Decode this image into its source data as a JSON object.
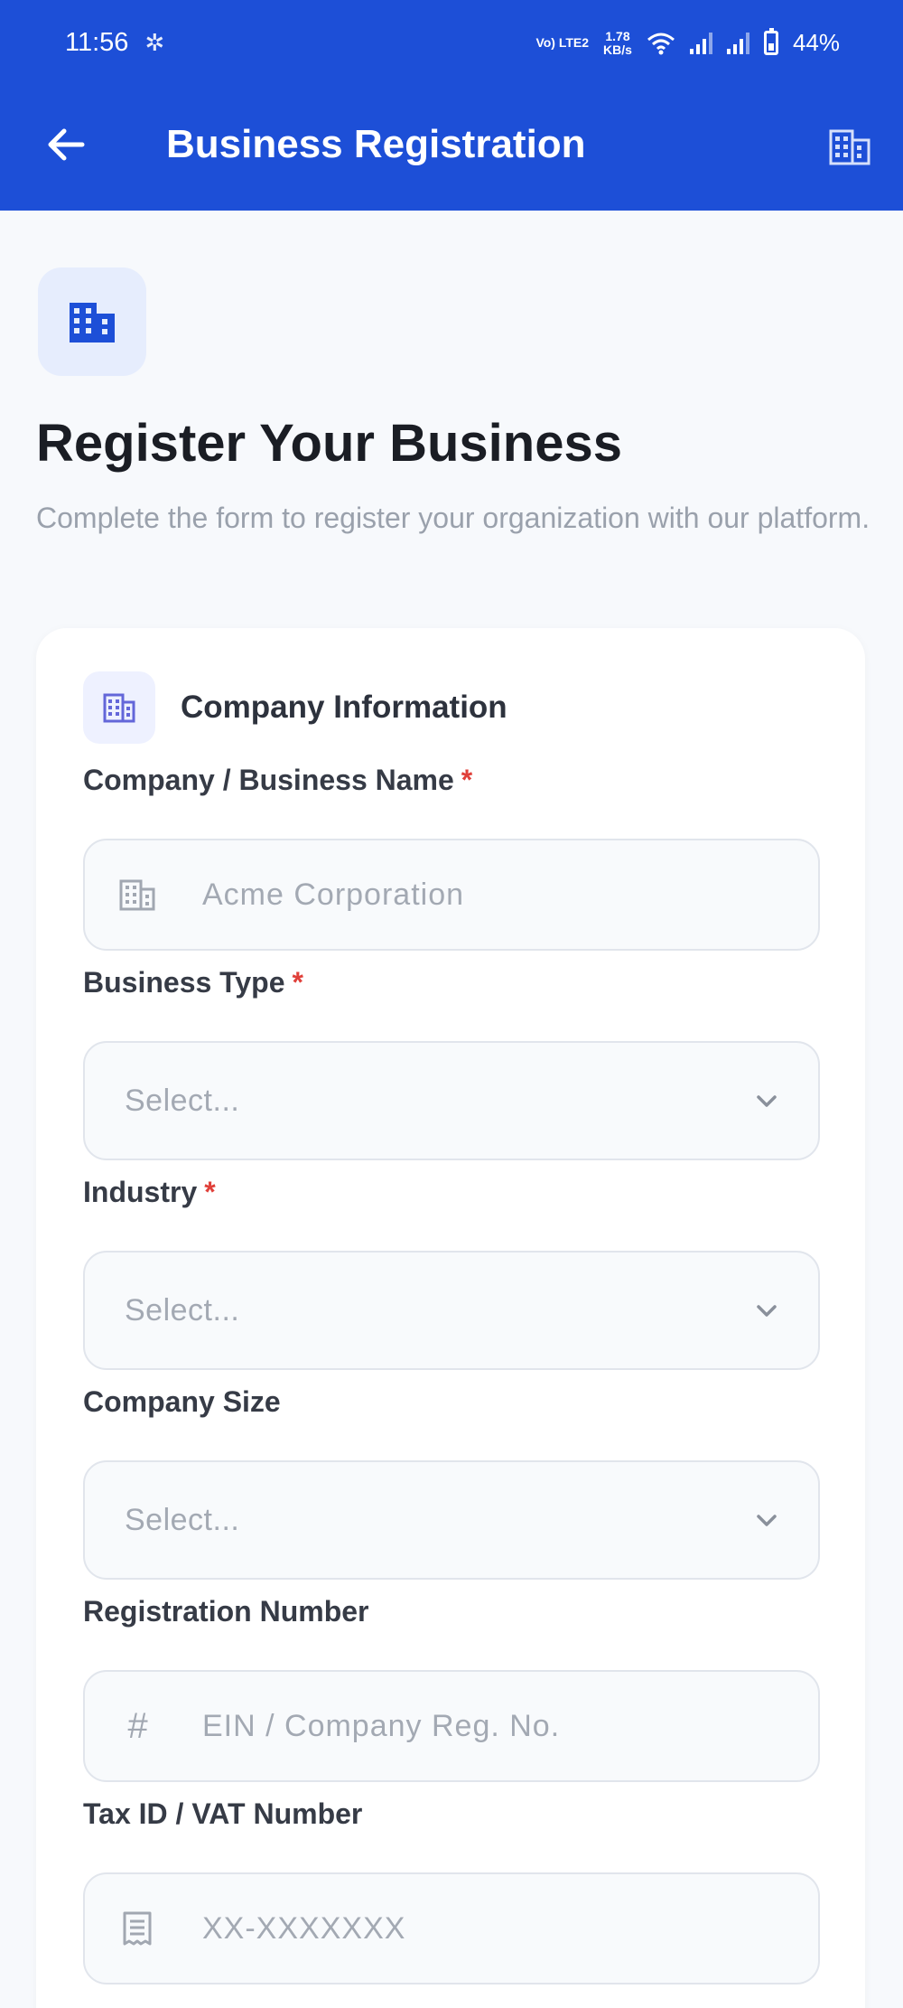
{
  "status_bar": {
    "time": "11:56",
    "volte": "Vo) LTE2",
    "speed_value": "1.78",
    "speed_unit": "KB/s",
    "battery": "44%"
  },
  "app_bar": {
    "title": "Business Registration",
    "back_icon": "arrow-left-icon",
    "right_icon": "building-icon"
  },
  "hero": {
    "icon": "building-icon",
    "title": "Register Your Business",
    "subtitle": "Complete the form to register your organization with our platform."
  },
  "section": {
    "icon": "building-icon",
    "title": "Company Information"
  },
  "fields": {
    "company_name": {
      "label": "Company / Business Name",
      "required": "*",
      "placeholder": "Acme Corporation",
      "icon": "building-icon"
    },
    "business_type": {
      "label": "Business Type",
      "required": "*",
      "selected": "Select..."
    },
    "industry": {
      "label": "Industry",
      "required": "*",
      "selected": "Select..."
    },
    "company_size": {
      "label": "Company Size",
      "selected": "Select..."
    },
    "registration_number": {
      "label": "Registration Number",
      "placeholder": "EIN / Company Reg. No.",
      "icon": "hash-icon"
    },
    "tax_id": {
      "label": "Tax ID / VAT Number",
      "placeholder": "XX-XXXXXXX",
      "icon": "receipt-icon"
    }
  },
  "colors": {
    "primary": "#1d4fd7",
    "background": "#f7f9fc",
    "required": "#e0403a",
    "placeholder": "#a3a9b3"
  }
}
